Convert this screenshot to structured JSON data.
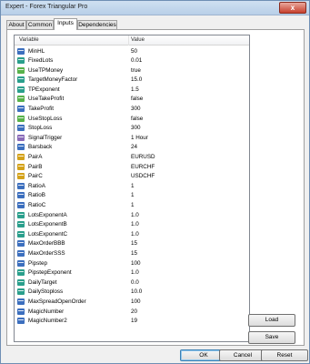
{
  "window": {
    "title": "Expert - Forex Triangular Pro",
    "close_label": "x"
  },
  "tabs": [
    {
      "label": "About"
    },
    {
      "label": "Common"
    },
    {
      "label": "Inputs"
    },
    {
      "label": "Dependencies"
    }
  ],
  "active_tab": "Inputs",
  "table": {
    "columns": [
      "Variable",
      "Value"
    ],
    "rows": [
      {
        "icon": "int",
        "name": "MinHL",
        "value": "50"
      },
      {
        "icon": "dbl",
        "name": "FixedLots",
        "value": "0.01"
      },
      {
        "icon": "bool",
        "name": "UseTPMoney",
        "value": "true"
      },
      {
        "icon": "dbl",
        "name": "TargetMoneyFactor",
        "value": "15.0"
      },
      {
        "icon": "dbl",
        "name": "TPExponent",
        "value": "1.5"
      },
      {
        "icon": "bool",
        "name": "UseTakeProfit",
        "value": "false"
      },
      {
        "icon": "int",
        "name": "TakeProfit",
        "value": "300"
      },
      {
        "icon": "bool",
        "name": "UseStopLoss",
        "value": "false"
      },
      {
        "icon": "int",
        "name": "StopLoss",
        "value": "300"
      },
      {
        "icon": "enum",
        "name": "SignalTrigger",
        "value": "1 Hour"
      },
      {
        "icon": "int",
        "name": "Barsback",
        "value": "24"
      },
      {
        "icon": "str",
        "name": "PairA",
        "value": "EURUSD"
      },
      {
        "icon": "str",
        "name": "PairB",
        "value": "EURCHF"
      },
      {
        "icon": "str",
        "name": "PairC",
        "value": "USDCHF"
      },
      {
        "icon": "int",
        "name": "RatioA",
        "value": "1"
      },
      {
        "icon": "int",
        "name": "RatioB",
        "value": "1"
      },
      {
        "icon": "int",
        "name": "RatioC",
        "value": "1"
      },
      {
        "icon": "dbl",
        "name": "LotsExponentA",
        "value": "1.0"
      },
      {
        "icon": "dbl",
        "name": "LotsExponentB",
        "value": "1.0"
      },
      {
        "icon": "dbl",
        "name": "LotsExponentC",
        "value": "1.0"
      },
      {
        "icon": "int",
        "name": "MaxOrderBBB",
        "value": "15"
      },
      {
        "icon": "int",
        "name": "MaxOrderSSS",
        "value": "15"
      },
      {
        "icon": "int",
        "name": "Pipstep",
        "value": "100"
      },
      {
        "icon": "dbl",
        "name": "PipstepExponent",
        "value": "1.0"
      },
      {
        "icon": "dbl",
        "name": "DailyTarget",
        "value": "0.0"
      },
      {
        "icon": "dbl",
        "name": "DailyStoploss",
        "value": "10.0"
      },
      {
        "icon": "int",
        "name": "MaxSpreadOpenOrder",
        "value": "100"
      },
      {
        "icon": "int",
        "name": "MagicNumber",
        "value": "20"
      },
      {
        "icon": "int",
        "name": "MagicNumber2",
        "value": "19"
      }
    ]
  },
  "buttons": {
    "load": "Load",
    "save": "Save",
    "ok": "OK",
    "cancel": "Cancel",
    "reset": "Reset"
  },
  "icons": {
    "int": "integer-param-icon",
    "dbl": "double-param-icon",
    "bool": "bool-param-icon",
    "enum": "enum-param-icon",
    "str": "string-param-icon"
  }
}
